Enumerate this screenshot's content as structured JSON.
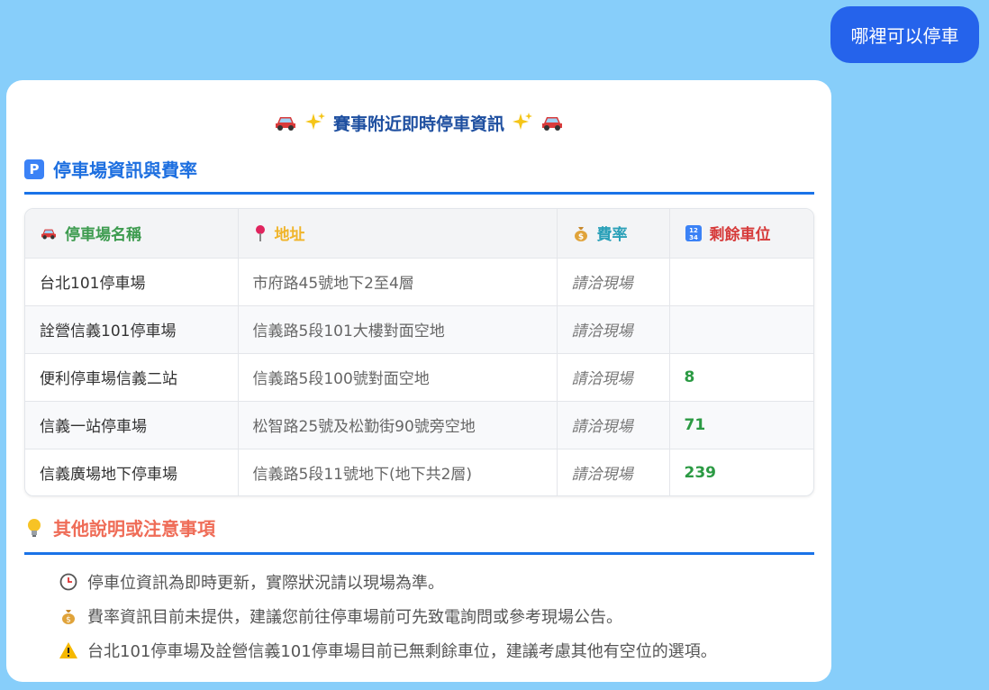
{
  "chat": {
    "user_message": "哪裡可以停車"
  },
  "card": {
    "title": "賽事附近即時停車資訊",
    "section1_title": "停車場資訊與費率",
    "section2_title": "其他說明或注意事項",
    "table": {
      "headers": [
        "停車場名稱",
        "地址",
        "費率",
        "剩餘車位"
      ],
      "header_icons": [
        "car-icon",
        "pin-icon",
        "money-bag-icon",
        "numbers-icon"
      ],
      "rows": [
        {
          "name": "台北101停車場",
          "address": "市府路45號地下2至4層",
          "fee": "請洽現場",
          "spaces": ""
        },
        {
          "name": "詮營信義101停車場",
          "address": "信義路5段101大樓對面空地",
          "fee": "請洽現場",
          "spaces": ""
        },
        {
          "name": "便利停車場信義二站",
          "address": "信義路5段100號對面空地",
          "fee": "請洽現場",
          "spaces": "8"
        },
        {
          "name": "信義一站停車場",
          "address": "松智路25號及松勤街90號旁空地",
          "fee": "請洽現場",
          "spaces": "71"
        },
        {
          "name": "信義廣場地下停車場",
          "address": "信義路5段11號地下(地下共2層)",
          "fee": "請洽現場",
          "spaces": "239"
        }
      ]
    },
    "notes": [
      {
        "icon": "clock-icon",
        "text": "停車位資訊為即時更新，實際狀況請以現場為準。"
      },
      {
        "icon": "money-bag-icon",
        "text": "費率資訊目前未提供，建議您前往停車場前可先致電詢問或參考現場公告。"
      },
      {
        "icon": "warning-icon",
        "text": "台北101停車場及詮營信義101停車場目前已無剩餘車位，建議考慮其他有空位的選項。"
      }
    ]
  },
  "colors": {
    "background": "#87CEFA",
    "user_bubble": "#2563EB",
    "accent_blue": "#1a73e8",
    "available_green": "#2b9a43"
  }
}
